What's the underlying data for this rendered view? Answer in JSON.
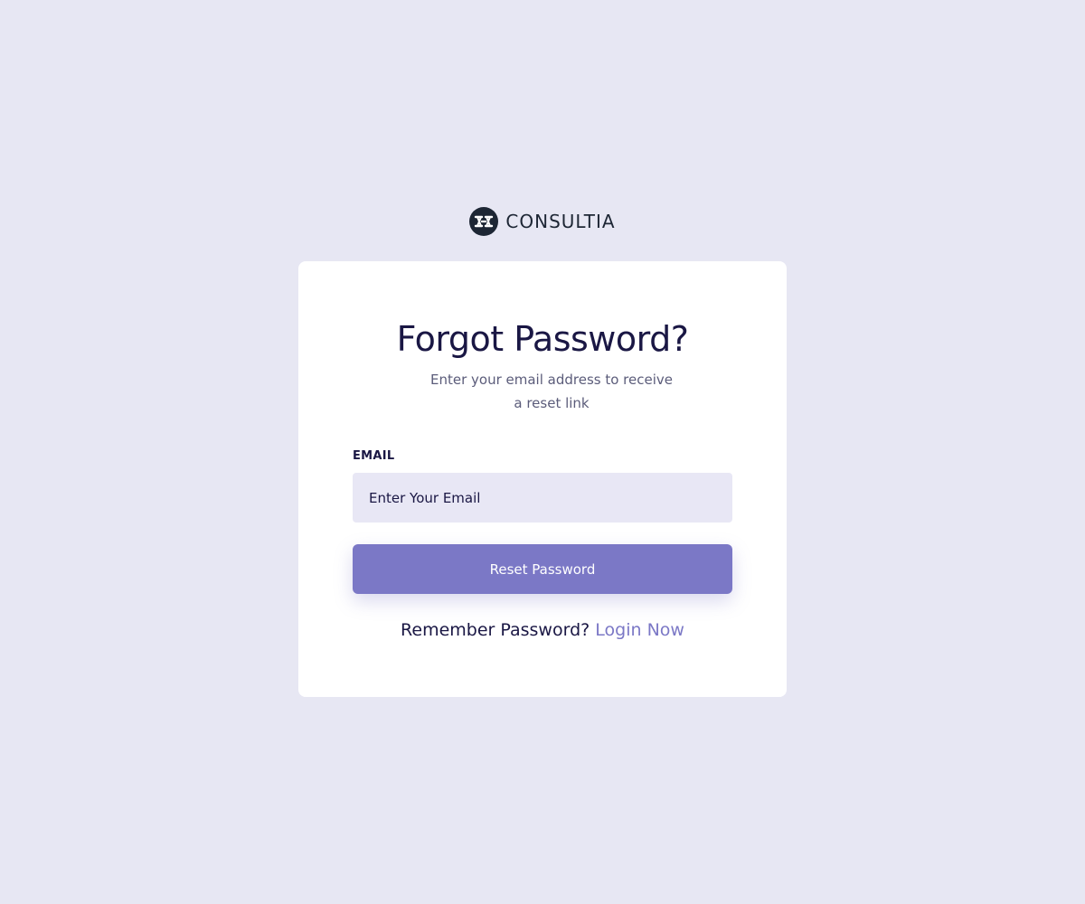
{
  "brand": {
    "name": "CONSULTIA",
    "logo_icon": "consultia-logo-icon",
    "logo_color": "#1d2634"
  },
  "form": {
    "title": "Forgot Password?",
    "subtitle": "Enter your email address to receive a reset link",
    "email_label": "EMAIL",
    "email_placeholder": "Enter Your Email",
    "email_value": "",
    "submit_label": "Reset Password",
    "remember_text": "Remember Password?",
    "login_link": "Login Now"
  },
  "colors": {
    "background": "#e7e7f3",
    "card": "#ffffff",
    "heading": "#1a1744",
    "accent": "#7b78c6",
    "input_background": "#e8e7f5"
  }
}
